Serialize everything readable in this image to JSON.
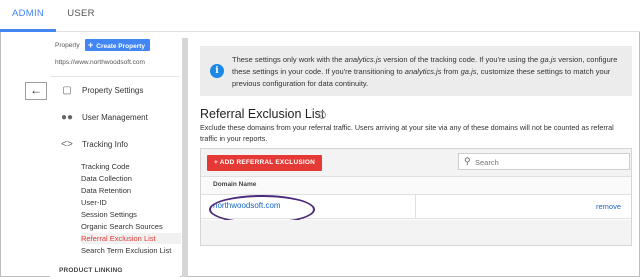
{
  "tabs": {
    "admin": "ADMIN",
    "user": "USER"
  },
  "sidebar": {
    "property_label": "Property",
    "create_property": "Create Property",
    "property_url": "https://www.northwoodsoft.com",
    "nav": {
      "property_settings": "Property Settings",
      "user_management": "User Management",
      "tracking_info": "Tracking Info"
    },
    "tracking_sub": [
      "Tracking Code",
      "Data Collection",
      "Data Retention",
      "User-ID",
      "Session Settings",
      "Organic Search Sources",
      "Referral Exclusion List",
      "Search Term Exclusion List"
    ],
    "active_sub": "Referral Exclusion List",
    "product_linking": "PRODUCT LINKING"
  },
  "info": {
    "line1a": "These settings only work with the ",
    "line1b": "analytics.js",
    "line1c": " version of the tracking code. If you're using the ",
    "line1d": "ga.js",
    "line1e": " version, configure",
    "line2a": "these settings in your code. If you're transitioning to ",
    "line2b": "analytics.js",
    "line2c": " from ",
    "line2d": "ga.js",
    "line2e": ", customize these settings to match your",
    "line3": "previous configuration for data continuity."
  },
  "main": {
    "title": "Referral Exclusion List",
    "help_icon_text": "?",
    "description": "Exclude these domains from your referral traffic. Users arriving at your site via any of these domains will not be counted as referral traffic in your reports.",
    "add_button": "+ ADD REFERRAL EXCLUSION",
    "search_placeholder": "Search",
    "column_header": "Domain Name",
    "rows": [
      {
        "domain": "northwoodsoft.com",
        "action": "remove"
      }
    ]
  },
  "colors": {
    "accent_blue": "#4285f4",
    "add_red": "#e53935",
    "link_blue": "#1565c0",
    "highlight_oval": "#4a2a7a"
  },
  "icons": {
    "collapse": "arrow-left-icon",
    "property_settings": "document-icon",
    "user_management": "people-icon",
    "tracking_info": "code-brackets-icon",
    "info": "info-icon",
    "search": "search-icon",
    "help": "help-icon"
  }
}
